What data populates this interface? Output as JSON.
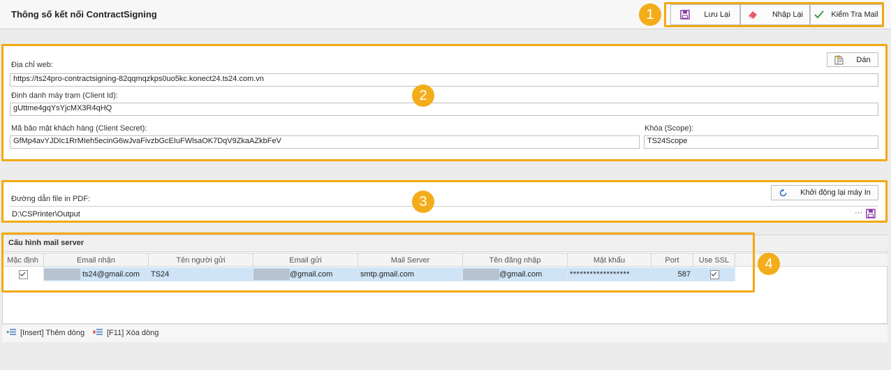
{
  "page": {
    "title": "Thông số kết nối ContractSigning"
  },
  "toolbar": {
    "save_label": "Lưu Lại",
    "reset_label": "Nhập Lại",
    "check_mail_label": "Kiểm Tra Mail"
  },
  "badges": {
    "b1": "1",
    "b2": "2",
    "b3": "3",
    "b4": "4"
  },
  "connection": {
    "paste_label": "Dán",
    "web_address_label": "Địa chỉ web:",
    "web_address_value": "https://ts24pro-contractsigning-82qqmqzkps0uo5kc.konect24.ts24.com.vn",
    "client_id_label": "Định danh máy trạm (Client Id):",
    "client_id_value": "gUttme4gqYsYjcMX3R4qHQ",
    "client_secret_label": "Mã bảo mật khách hàng (Client Secret):",
    "client_secret_value": "GfMp4avYJDIc1RrMIeh5ecinG6wJvaFivzbGcEIuFWlsaOK7DqV9ZkaAZkbFeV",
    "scope_label": "Khóa (Scope):",
    "scope_value": "TS24Scope"
  },
  "printer": {
    "restart_label": "Khởi động lại máy In",
    "pdf_path_label": "Đường dẫn file in PDF:",
    "pdf_path_value": "D:\\CSPrinter\\Output",
    "ellipsis": "···"
  },
  "mail": {
    "section_title": "Cấu hình mail server",
    "columns": [
      "Mặc định",
      "Email nhận",
      "Tên người gửi",
      "Email gửi",
      "Mail Server",
      "Tên đăng nhập",
      "Mật khẩu",
      "Port",
      "Use SSL"
    ],
    "row": {
      "default": true,
      "email_to": "ts24@gmail.com",
      "sender_name": "TS24",
      "email_from": "@gmail.com",
      "mail_server": "smtp.gmail.com",
      "username": "@gmail.com",
      "password": "******************",
      "port": "587",
      "use_ssl": true
    }
  },
  "footer": {
    "insert_label": "[Insert] Thêm dòng",
    "delete_label": "[F11] Xóa dòng"
  },
  "colors": {
    "accent": "#f2a90f",
    "badge": "#f4ad1a",
    "selected_row": "#cfe4f6",
    "check_green": "#3a9a4a"
  }
}
